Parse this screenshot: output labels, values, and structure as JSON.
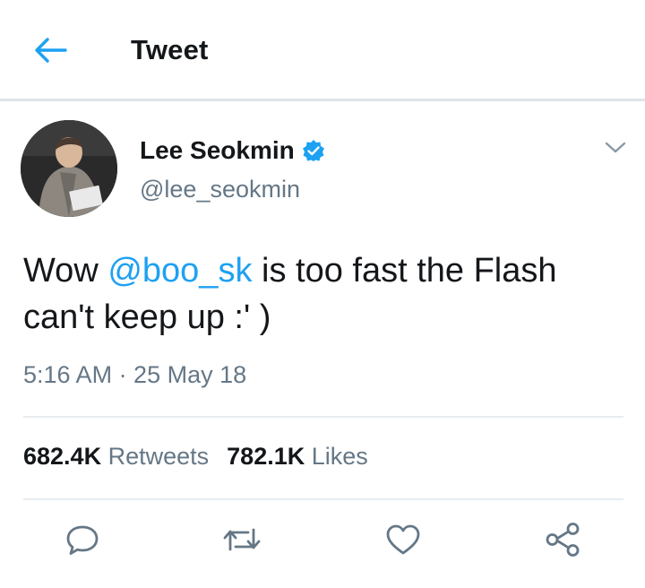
{
  "header": {
    "title": "Tweet",
    "back_icon": "arrow-left-icon",
    "accent_color": "#1da1f2"
  },
  "tweet": {
    "author": {
      "name": "Lee Seokmin",
      "handle": "@lee_seokmin",
      "verified": true,
      "verified_icon": "verified-badge-icon"
    },
    "text_before": "Wow ",
    "mention": "@boo_sk",
    "text_after": " is too fast the Flash can't keep up :' )",
    "timestamp": "5:16 AM · 25 May 18",
    "menu_icon": "chevron-down-icon"
  },
  "stats": {
    "retweets_count": "682.4K",
    "retweets_label": "Retweets",
    "likes_count": "782.1K",
    "likes_label": "Likes"
  },
  "actions": [
    {
      "icon": "reply-icon"
    },
    {
      "icon": "retweet-icon"
    },
    {
      "icon": "like-icon"
    },
    {
      "icon": "share-icon"
    }
  ],
  "colors": {
    "text_primary": "#14171a",
    "text_secondary": "#657786",
    "divider": "#e6ecf0"
  }
}
